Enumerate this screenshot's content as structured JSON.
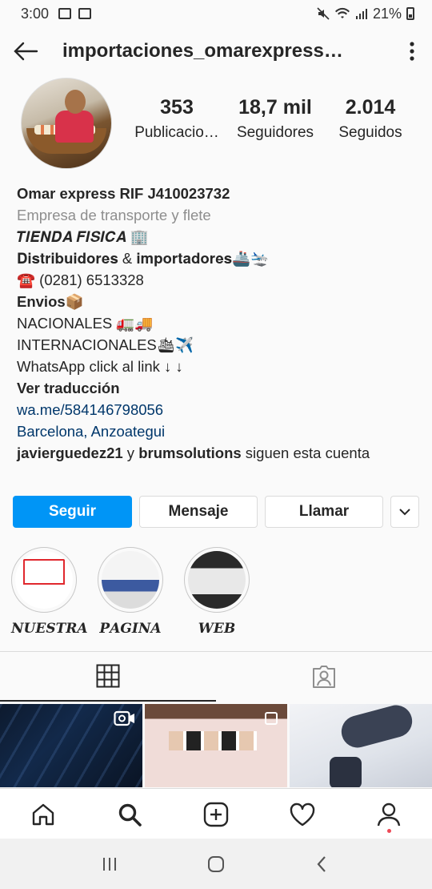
{
  "status_bar": {
    "time": "3:00",
    "battery": "21%"
  },
  "header": {
    "username": "importaciones_omarexpress…",
    "back_icon": "arrow-left-icon",
    "more_icon": "vertical-dots-icon"
  },
  "profile": {
    "stats": [
      {
        "value": "353",
        "label": "Publicacio…"
      },
      {
        "value": "18,7 mil",
        "label": "Seguidores"
      },
      {
        "value": "2.014",
        "label": "Seguidos"
      }
    ],
    "bio": {
      "name": "Omar express RIF J410023732",
      "category": "Empresa de transporte y flete",
      "line_store": "𝑻𝑰𝑬𝑵𝑫𝑨 𝑭𝑰𝑺𝑰𝑪𝑨 🏢",
      "line_distributors": "𝐃𝐢𝐬𝐭𝐫𝐢𝐛𝐮𝐢𝐝𝐨𝐫𝐞𝐬 & 𝐢𝐦𝐩𝐨𝐫𝐭𝐚𝐝𝐨𝐫𝐞𝐬🚢🛬",
      "line_phone": "☎️ (0281) 6513328",
      "line_envios": "Envios📦",
      "line_nacionales": "NACIONALES 🚛🚚",
      "line_internacionales": "INTERNACIONALES🛳✈️",
      "line_whatsapp": "WhatsApp click al link ↓ ↓",
      "translate": "Ver traducción",
      "link": "wa.me/584146798056",
      "location": "Barcelona, Anzoategui",
      "followed_by_1": "javierguedez21",
      "followed_by_and": " y ",
      "followed_by_2": "brumsolutions",
      "followed_by_suffix": " siguen esta cuenta"
    }
  },
  "actions": {
    "follow": "Seguir",
    "message": "Mensaje",
    "call": "Llamar",
    "more_icon": "chevron-down-icon"
  },
  "highlights": [
    {
      "label": "𝑵𝑼𝑬𝑺𝑻𝑹𝑨"
    },
    {
      "label": "𝑷𝑨𝑮𝑰𝑵𝑨"
    },
    {
      "label": "𝑾𝑬𝑩"
    }
  ],
  "tabs": {
    "grid_icon": "grid-icon",
    "tagged_icon": "tagged-person-icon"
  },
  "bottom_nav": [
    "home-icon",
    "search-icon",
    "add-post-icon",
    "heart-icon",
    "profile-icon"
  ],
  "colors": {
    "accent": "#0095f6",
    "link": "#00376b",
    "notification": "#ed4956"
  }
}
